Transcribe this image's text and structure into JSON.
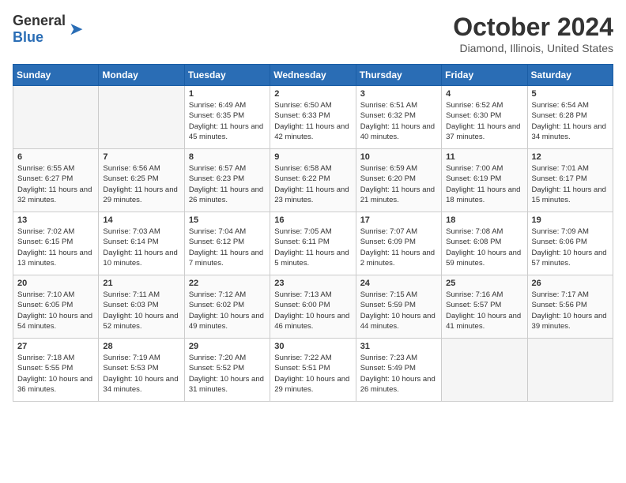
{
  "header": {
    "logo_general": "General",
    "logo_blue": "Blue",
    "month_title": "October 2024",
    "location": "Diamond, Illinois, United States"
  },
  "weekdays": [
    "Sunday",
    "Monday",
    "Tuesday",
    "Wednesday",
    "Thursday",
    "Friday",
    "Saturday"
  ],
  "weeks": [
    [
      {
        "day": "",
        "empty": true
      },
      {
        "day": "",
        "empty": true
      },
      {
        "day": "1",
        "sunrise": "6:49 AM",
        "sunset": "6:35 PM",
        "daylight": "11 hours and 45 minutes."
      },
      {
        "day": "2",
        "sunrise": "6:50 AM",
        "sunset": "6:33 PM",
        "daylight": "11 hours and 42 minutes."
      },
      {
        "day": "3",
        "sunrise": "6:51 AM",
        "sunset": "6:32 PM",
        "daylight": "11 hours and 40 minutes."
      },
      {
        "day": "4",
        "sunrise": "6:52 AM",
        "sunset": "6:30 PM",
        "daylight": "11 hours and 37 minutes."
      },
      {
        "day": "5",
        "sunrise": "6:54 AM",
        "sunset": "6:28 PM",
        "daylight": "11 hours and 34 minutes."
      }
    ],
    [
      {
        "day": "6",
        "sunrise": "6:55 AM",
        "sunset": "6:27 PM",
        "daylight": "11 hours and 32 minutes."
      },
      {
        "day": "7",
        "sunrise": "6:56 AM",
        "sunset": "6:25 PM",
        "daylight": "11 hours and 29 minutes."
      },
      {
        "day": "8",
        "sunrise": "6:57 AM",
        "sunset": "6:23 PM",
        "daylight": "11 hours and 26 minutes."
      },
      {
        "day": "9",
        "sunrise": "6:58 AM",
        "sunset": "6:22 PM",
        "daylight": "11 hours and 23 minutes."
      },
      {
        "day": "10",
        "sunrise": "6:59 AM",
        "sunset": "6:20 PM",
        "daylight": "11 hours and 21 minutes."
      },
      {
        "day": "11",
        "sunrise": "7:00 AM",
        "sunset": "6:19 PM",
        "daylight": "11 hours and 18 minutes."
      },
      {
        "day": "12",
        "sunrise": "7:01 AM",
        "sunset": "6:17 PM",
        "daylight": "11 hours and 15 minutes."
      }
    ],
    [
      {
        "day": "13",
        "sunrise": "7:02 AM",
        "sunset": "6:15 PM",
        "daylight": "11 hours and 13 minutes."
      },
      {
        "day": "14",
        "sunrise": "7:03 AM",
        "sunset": "6:14 PM",
        "daylight": "11 hours and 10 minutes."
      },
      {
        "day": "15",
        "sunrise": "7:04 AM",
        "sunset": "6:12 PM",
        "daylight": "11 hours and 7 minutes."
      },
      {
        "day": "16",
        "sunrise": "7:05 AM",
        "sunset": "6:11 PM",
        "daylight": "11 hours and 5 minutes."
      },
      {
        "day": "17",
        "sunrise": "7:07 AM",
        "sunset": "6:09 PM",
        "daylight": "11 hours and 2 minutes."
      },
      {
        "day": "18",
        "sunrise": "7:08 AM",
        "sunset": "6:08 PM",
        "daylight": "10 hours and 59 minutes."
      },
      {
        "day": "19",
        "sunrise": "7:09 AM",
        "sunset": "6:06 PM",
        "daylight": "10 hours and 57 minutes."
      }
    ],
    [
      {
        "day": "20",
        "sunrise": "7:10 AM",
        "sunset": "6:05 PM",
        "daylight": "10 hours and 54 minutes."
      },
      {
        "day": "21",
        "sunrise": "7:11 AM",
        "sunset": "6:03 PM",
        "daylight": "10 hours and 52 minutes."
      },
      {
        "day": "22",
        "sunrise": "7:12 AM",
        "sunset": "6:02 PM",
        "daylight": "10 hours and 49 minutes."
      },
      {
        "day": "23",
        "sunrise": "7:13 AM",
        "sunset": "6:00 PM",
        "daylight": "10 hours and 46 minutes."
      },
      {
        "day": "24",
        "sunrise": "7:15 AM",
        "sunset": "5:59 PM",
        "daylight": "10 hours and 44 minutes."
      },
      {
        "day": "25",
        "sunrise": "7:16 AM",
        "sunset": "5:57 PM",
        "daylight": "10 hours and 41 minutes."
      },
      {
        "day": "26",
        "sunrise": "7:17 AM",
        "sunset": "5:56 PM",
        "daylight": "10 hours and 39 minutes."
      }
    ],
    [
      {
        "day": "27",
        "sunrise": "7:18 AM",
        "sunset": "5:55 PM",
        "daylight": "10 hours and 36 minutes."
      },
      {
        "day": "28",
        "sunrise": "7:19 AM",
        "sunset": "5:53 PM",
        "daylight": "10 hours and 34 minutes."
      },
      {
        "day": "29",
        "sunrise": "7:20 AM",
        "sunset": "5:52 PM",
        "daylight": "10 hours and 31 minutes."
      },
      {
        "day": "30",
        "sunrise": "7:22 AM",
        "sunset": "5:51 PM",
        "daylight": "10 hours and 29 minutes."
      },
      {
        "day": "31",
        "sunrise": "7:23 AM",
        "sunset": "5:49 PM",
        "daylight": "10 hours and 26 minutes."
      },
      {
        "day": "",
        "empty": true
      },
      {
        "day": "",
        "empty": true
      }
    ]
  ],
  "labels": {
    "sunrise_prefix": "Sunrise: ",
    "sunset_prefix": "Sunset: ",
    "daylight_prefix": "Daylight: "
  }
}
